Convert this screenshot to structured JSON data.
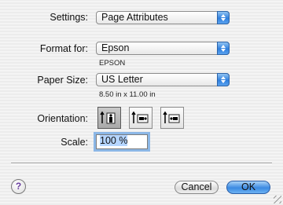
{
  "settings": {
    "label": "Settings:",
    "value": "Page Attributes"
  },
  "format_for": {
    "label": "Format for:",
    "value": "Epson",
    "subtext": "EPSON"
  },
  "paper_size": {
    "label": "Paper Size:",
    "value": "US Letter",
    "subtext": "8.50 in x 11.00 in"
  },
  "orientation": {
    "label": "Orientation:",
    "options": [
      "portrait",
      "landscape",
      "landscape-reversed"
    ],
    "selected": "portrait"
  },
  "scale": {
    "label": "Scale:",
    "value": "100 %"
  },
  "footer": {
    "help": "?",
    "cancel_label": "Cancel",
    "ok_label": "OK"
  }
}
